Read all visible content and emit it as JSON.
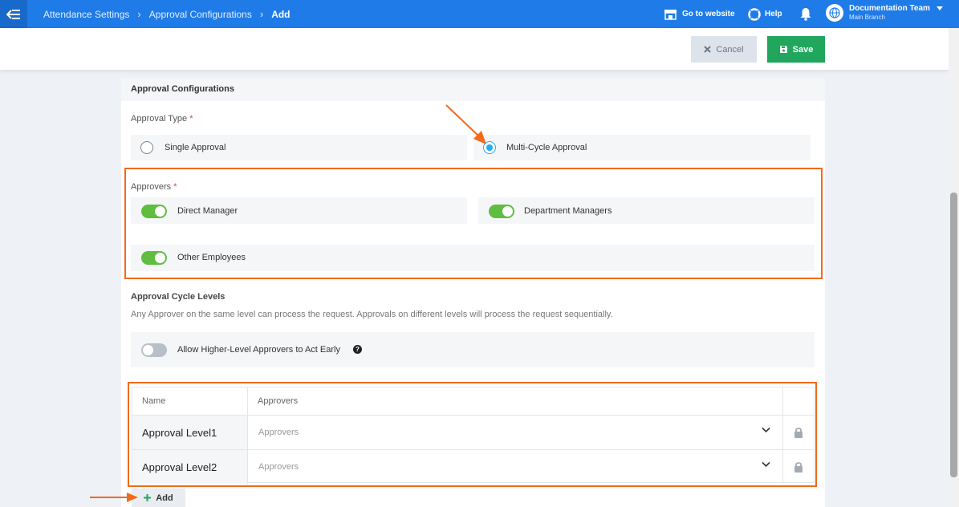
{
  "topbar": {
    "breadcrumb": [
      "Attendance Settings",
      "Approval Configurations",
      "Add"
    ],
    "go_to_website": "Go to website",
    "help": "Help",
    "team_name": "Documentation Team",
    "team_branch": "Main Branch",
    "colors": {
      "bar": "#1f7be8"
    }
  },
  "actions": {
    "cancel": "Cancel",
    "save": "Save"
  },
  "card": {
    "title": "Approval Configurations",
    "approval_type": {
      "label": "Approval Type",
      "required_mark": "*",
      "options": [
        {
          "label": "Single Approval",
          "selected": false
        },
        {
          "label": "Multi-Cycle Approval",
          "selected": true
        }
      ]
    },
    "approvers": {
      "label": "Approvers",
      "required_mark": "*",
      "toggles": [
        {
          "label": "Direct Manager",
          "on": true
        },
        {
          "label": "Department Managers",
          "on": true
        },
        {
          "label": "Other Employees",
          "on": true
        }
      ]
    },
    "cycle_levels": {
      "title": "Approval Cycle Levels",
      "description": "Any Approver on the same level can process the request. Approvals on different levels will process the request sequentially.",
      "early_toggle": {
        "label": "Allow Higher-Level Approvers to Act Early",
        "on": false
      }
    },
    "table": {
      "headers": {
        "name": "Name",
        "approvers": "Approvers"
      },
      "rows": [
        {
          "name": "Approval Level1",
          "approvers_placeholder": "Approvers"
        },
        {
          "name": "Approval Level2",
          "approvers_placeholder": "Approvers"
        }
      ]
    },
    "add_button": "Add"
  },
  "annotation_color": "#f26a1b"
}
